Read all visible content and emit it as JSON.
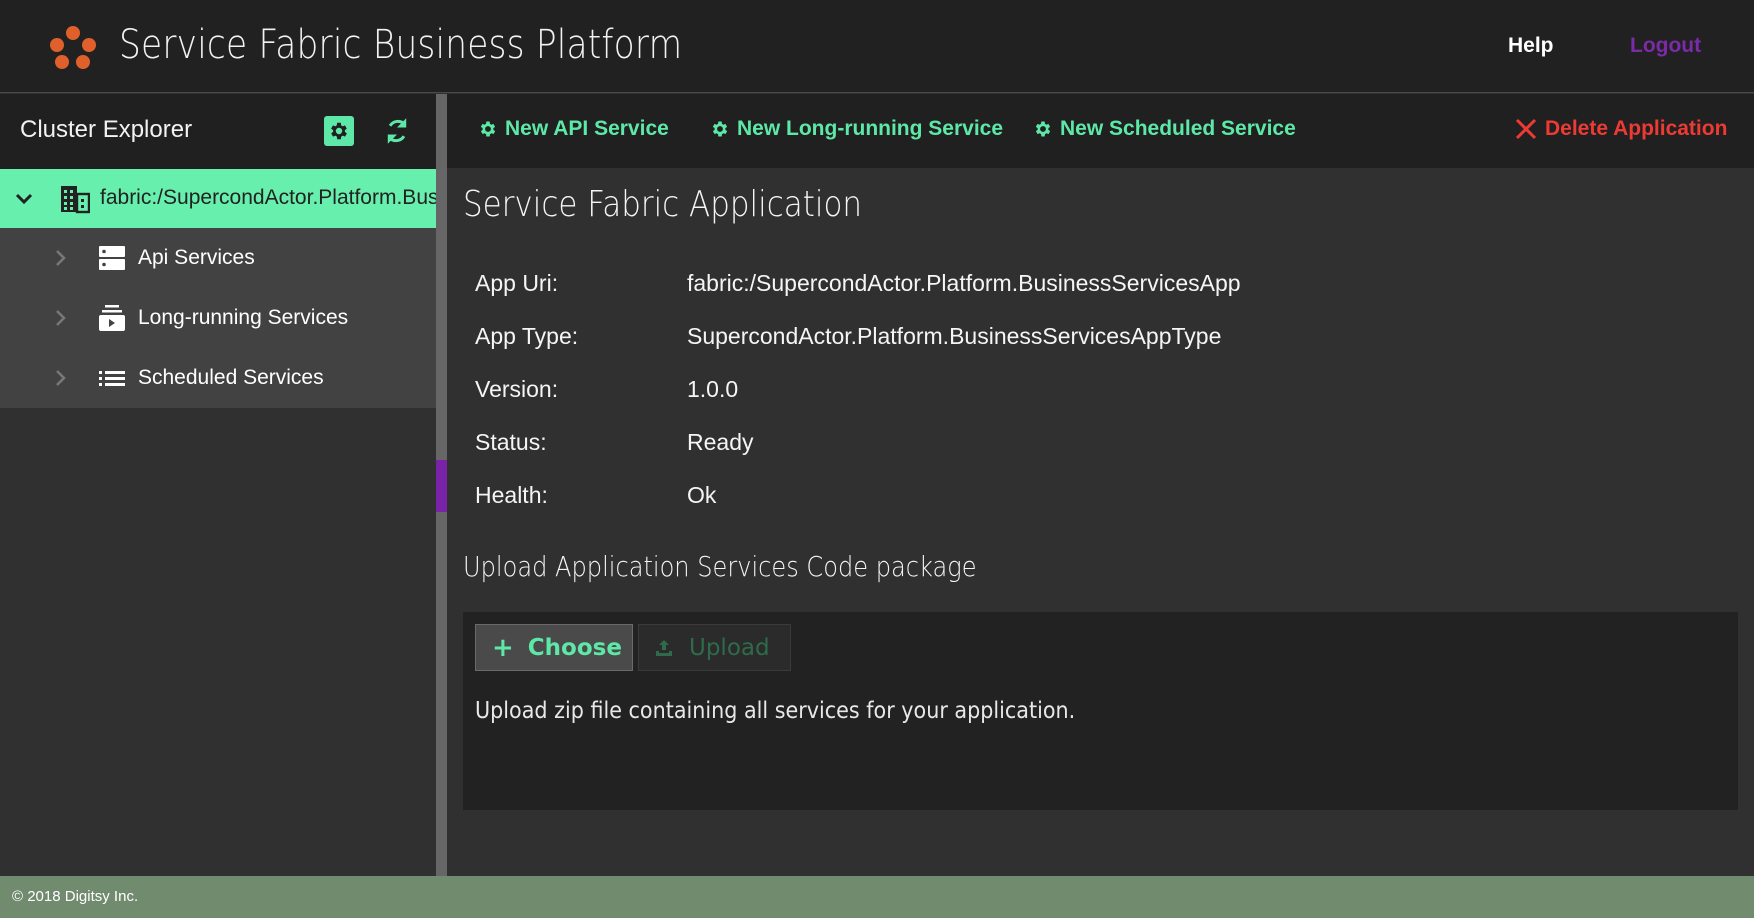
{
  "header": {
    "app_title": "Service Fabric Business Platform",
    "logo_icon": "five-dots-logo-icon",
    "help_label": "Help",
    "logout_label": "Logout"
  },
  "sidebar": {
    "title": "Cluster Explorer",
    "settings_icon": "gear-icon",
    "refresh_icon": "refresh-icon",
    "tree": {
      "root": {
        "label": "fabric:/SupercondActor.Platform.BusinessServicesApp",
        "icon": "building-icon",
        "expanded": true,
        "selected": true
      },
      "children": [
        {
          "label": "Api Services",
          "icon": "server-icon"
        },
        {
          "label": "Long-running Services",
          "icon": "play-stack-icon"
        },
        {
          "label": "Scheduled Services",
          "icon": "list-icon"
        }
      ]
    }
  },
  "toolbar": {
    "new_api_service": "New API Service",
    "new_long_running_service": "New Long-running Service",
    "new_scheduled_service": "New Scheduled Service",
    "delete_application": "Delete Application"
  },
  "main": {
    "title": "Service Fabric Application",
    "details": [
      {
        "label": "App Uri:",
        "value": "fabric:/SupercondActor.Platform.BusinessServicesApp"
      },
      {
        "label": "App Type:",
        "value": "SupercondActor.Platform.BusinessServicesAppType"
      },
      {
        "label": "Version:",
        "value": "1.0.0"
      },
      {
        "label": "Status:",
        "value": "Ready"
      },
      {
        "label": "Health:",
        "value": "Ok"
      }
    ],
    "upload": {
      "section_title": "Upload Application Services Code package",
      "choose_label": "Choose",
      "upload_label": "Upload",
      "hint": "Upload zip file containing all services for your application."
    }
  },
  "footer": {
    "copyright": "© 2018 Digitsy Inc."
  },
  "colors": {
    "accent_green": "#5de8a7",
    "selected_row": "#67efad",
    "danger": "#ee3a34",
    "logout_purple": "#7b2aa8",
    "logo_orange": "#e0602c",
    "footer_bg": "#718b6f"
  }
}
